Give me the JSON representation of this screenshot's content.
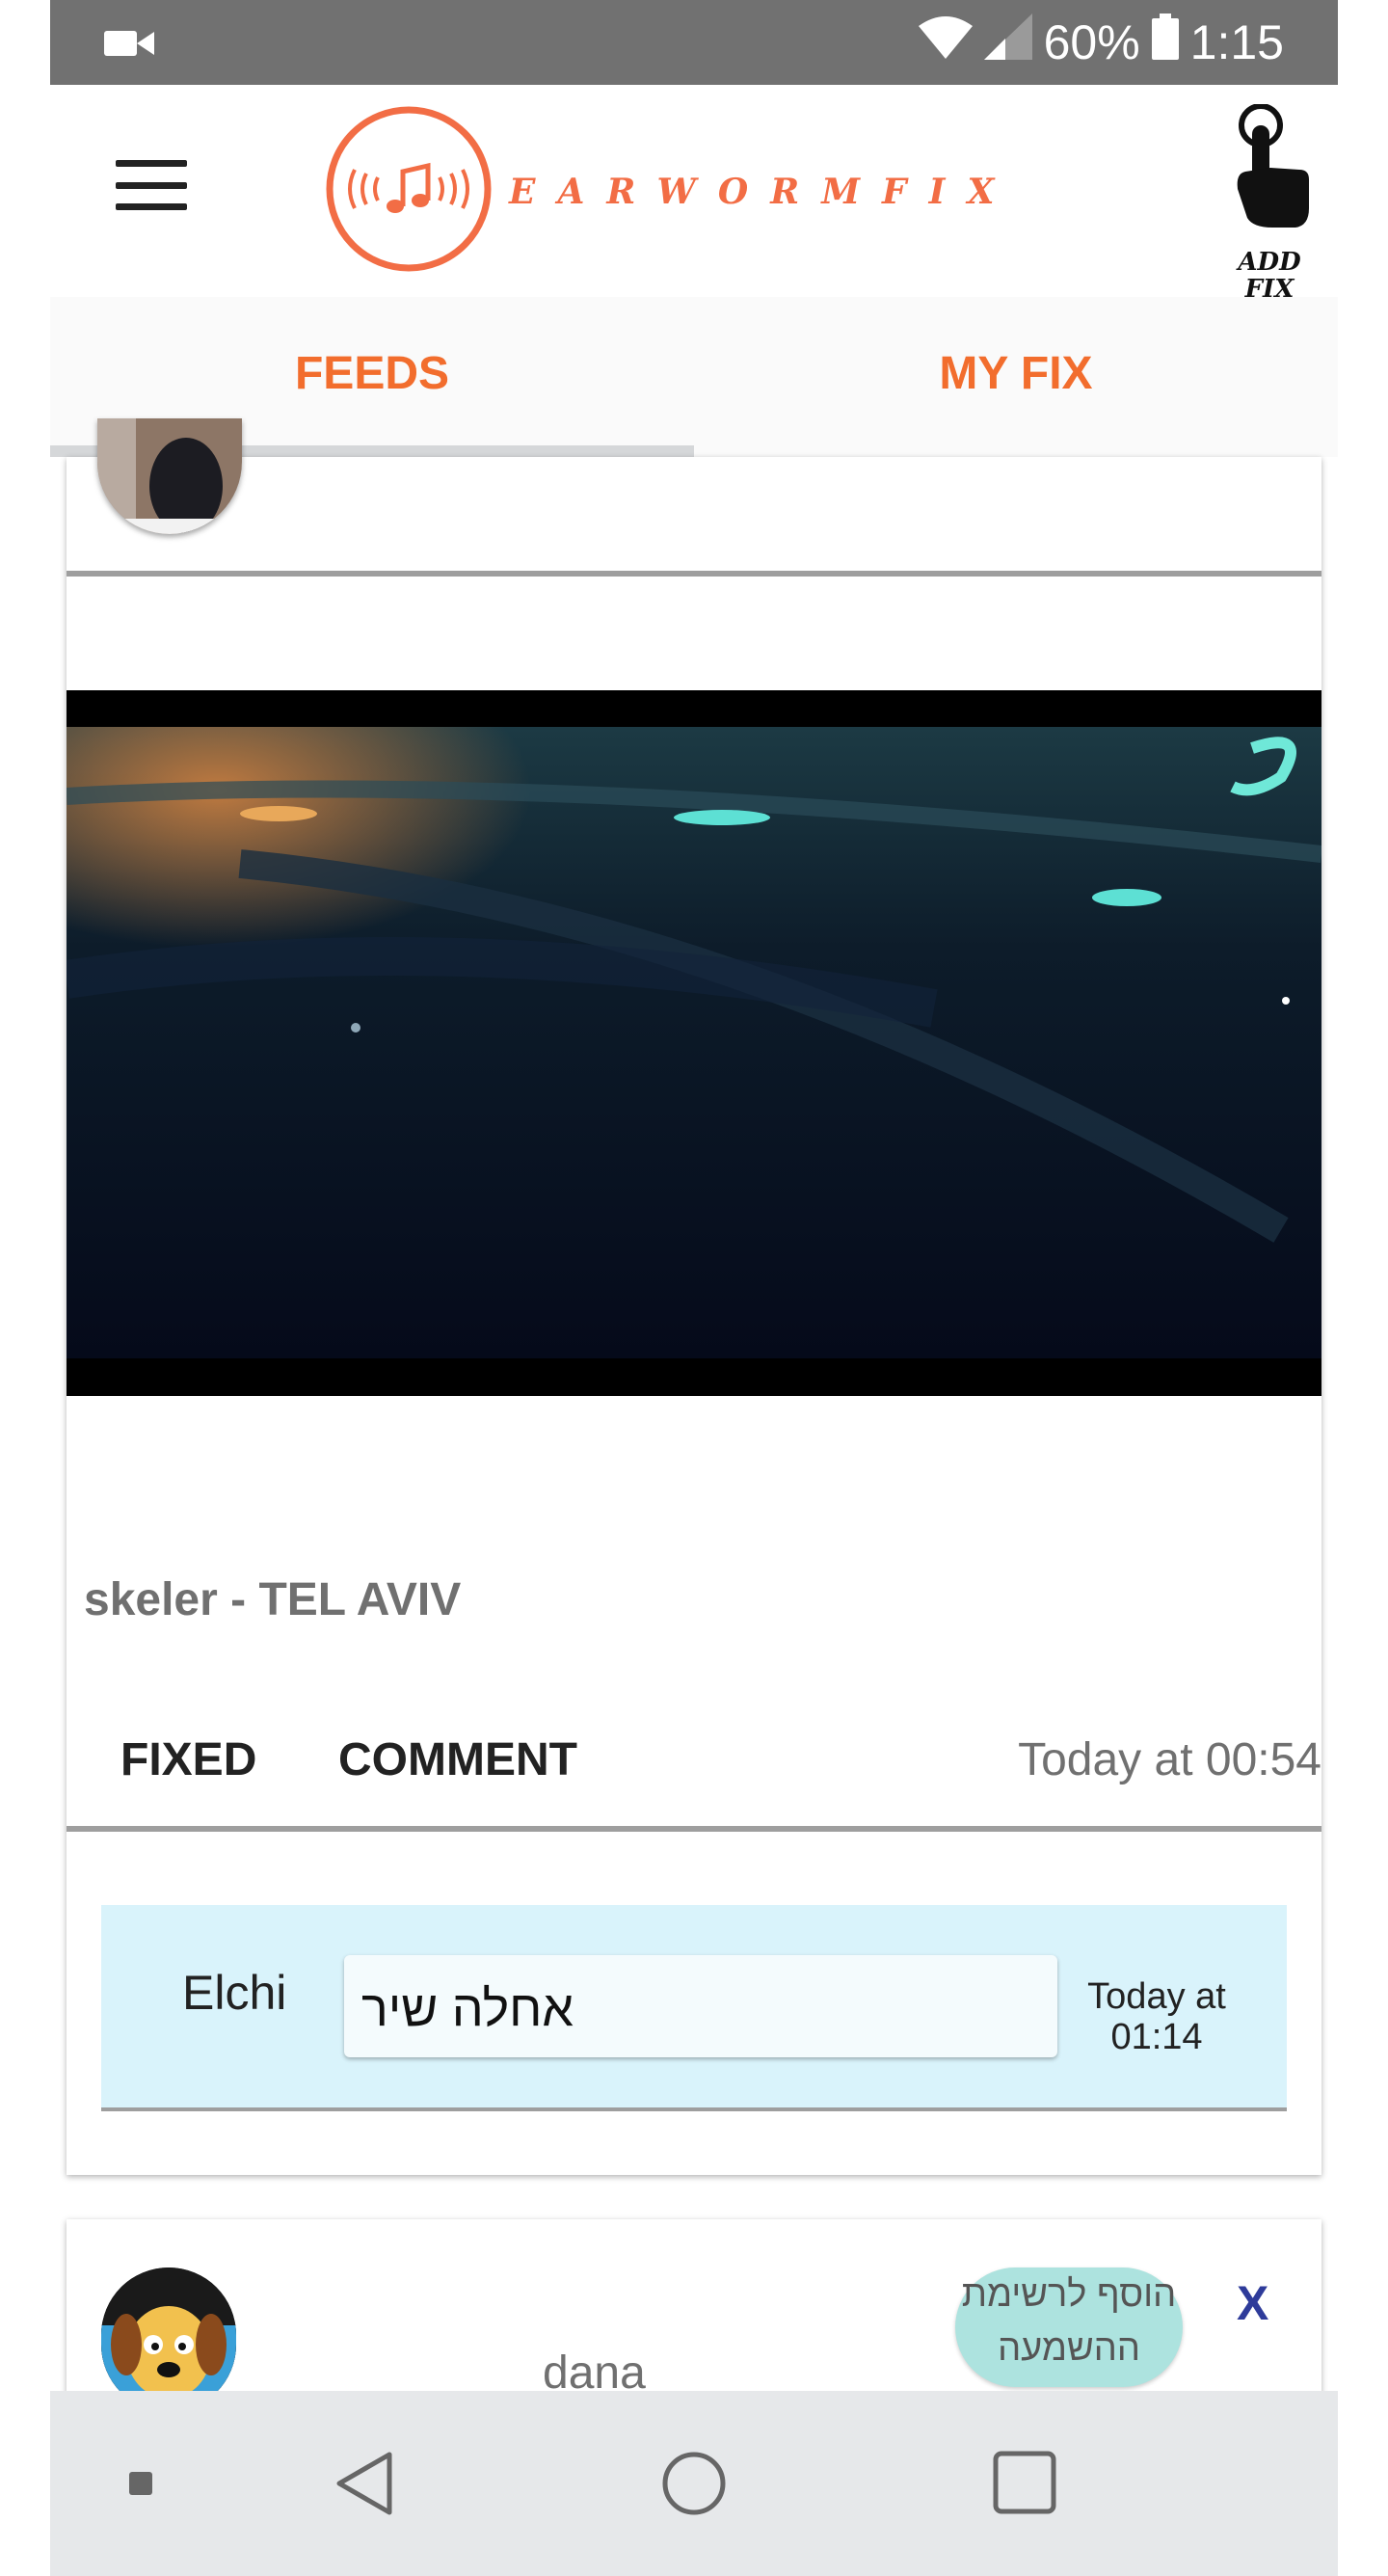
{
  "status_bar": {
    "battery": "60%",
    "time": "1:15"
  },
  "header": {
    "logo_text": "EARWORMFIX",
    "add_fix_label_1": "ADD",
    "add_fix_label_2": "FIX",
    "brand_color": "#f26d45"
  },
  "tabs": [
    {
      "label": "FEEDS",
      "active": true
    },
    {
      "label": "MY FIX",
      "active": false
    }
  ],
  "post": {
    "title": "skeler - TEL AVIV",
    "fixed_label": "FIXED",
    "comment_label": "COMMENT",
    "time": "Today at 00:54",
    "comment": {
      "user": "Elchi",
      "text": "אחלה שיר",
      "time_1": "Today at",
      "time_2": "01:14"
    }
  },
  "post2": {
    "user": "dana",
    "playlist_label_1": "הוסף לרשימת",
    "playlist_label_2": "ההשמעה",
    "close_label": "X"
  },
  "nav_bar": {
    "icons": [
      "square-dot-icon",
      "back-icon",
      "home-icon",
      "recents-icon"
    ]
  }
}
